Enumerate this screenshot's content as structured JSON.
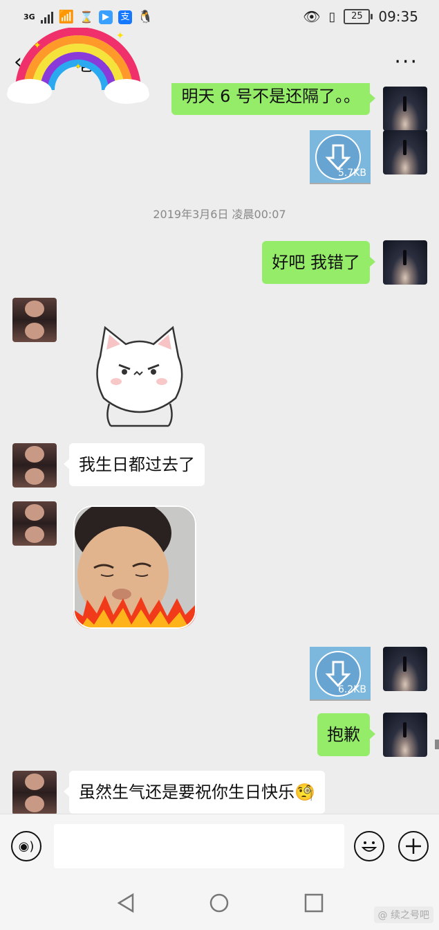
{
  "status_bar": {
    "network": "3G",
    "time": "09:35",
    "battery": "25"
  },
  "header": {
    "back_glyph": "‹",
    "title": "老师）",
    "more_glyph": "···"
  },
  "messages": {
    "m1": "明天 6 号不是还隔了。。",
    "file1_size": "5.7KB",
    "timestamp": "2019年3月6日 凌晨00:07",
    "m2": "好吧 我错了",
    "m3": "我生日都过去了",
    "file2_size": "6.2KB",
    "m4": "抱歉",
    "m5": "虽然生气还是要祝你生日快乐",
    "m5_emoji": "🧐"
  },
  "input": {
    "placeholder": ""
  },
  "watermark": "@ 续之号吧",
  "icons": {
    "voice": "voice-icon",
    "emoji": "emoji-icon",
    "plus": "plus-icon",
    "back_nav": "back-nav-icon",
    "home_nav": "home-nav-icon",
    "recent_nav": "recent-nav-icon"
  }
}
